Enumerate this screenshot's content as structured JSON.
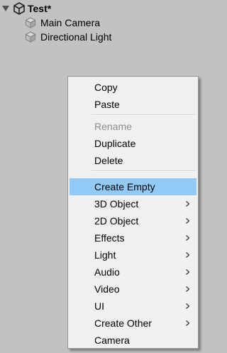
{
  "hierarchy": {
    "scene_name": "Test*",
    "children": [
      "Main Camera",
      "Directional Light"
    ]
  },
  "context_menu": {
    "copy": "Copy",
    "paste": "Paste",
    "rename": "Rename",
    "duplicate": "Duplicate",
    "delete": "Delete",
    "create_empty": "Create Empty",
    "object_3d": "3D Object",
    "object_2d": "2D Object",
    "effects": "Effects",
    "light": "Light",
    "audio": "Audio",
    "video": "Video",
    "ui": "UI",
    "create_other": "Create Other",
    "camera": "Camera"
  },
  "colors": {
    "background": "#c2c2c2",
    "menu_background": "#f0f0f0",
    "highlight": "#91c9f7",
    "disabled_text": "#8d8d8d"
  }
}
